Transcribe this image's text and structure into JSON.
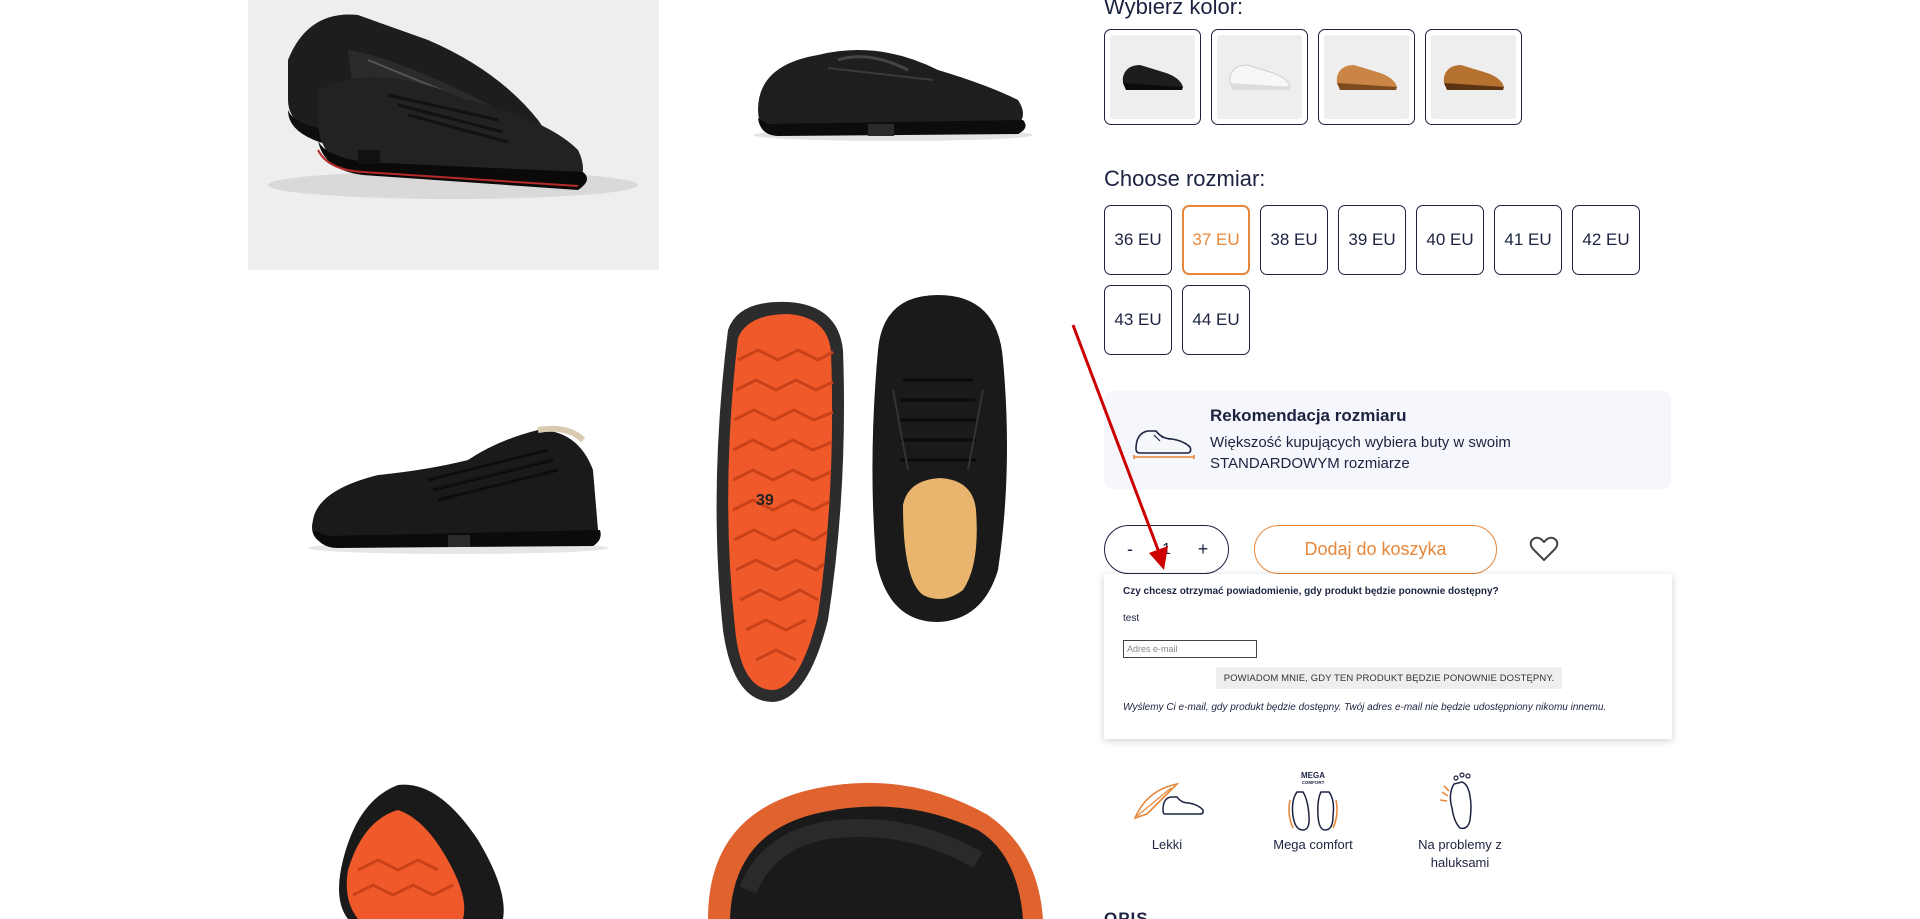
{
  "colors": {
    "accent": "#e8873a",
    "text": "#1c2340",
    "reco_bg": "#f5f7fc",
    "annotation_arrow": "#cc0000"
  },
  "gallery": {
    "images": [
      {
        "name": "black-shoe-pair-photo"
      },
      {
        "name": "black-shoe-side-photo"
      },
      {
        "name": "black-shoe-profile-photo"
      },
      {
        "name": "sole-and-top-photo"
      },
      {
        "name": "shoe-sole-angle-photo"
      },
      {
        "name": "shoe-flexed-photo"
      }
    ]
  },
  "color_picker": {
    "title": "Wybierz kolor:",
    "options": [
      {
        "name": "black"
      },
      {
        "name": "white"
      },
      {
        "name": "tan"
      },
      {
        "name": "brown"
      }
    ]
  },
  "size_picker": {
    "title": "Choose rozmiar:",
    "sizes": [
      "36 EU",
      "37 EU",
      "38 EU",
      "39 EU",
      "40 EU",
      "41 EU",
      "42 EU",
      "43 EU",
      "44 EU"
    ],
    "selected": "37 EU"
  },
  "recommendation": {
    "title": "Rekomendacja rozmiaru",
    "text": "Większość kupujących wybiera buty w swoim STANDARDOWYM rozmiarze"
  },
  "cart": {
    "minus": "-",
    "quantity": "1",
    "plus": "+",
    "add_label": "Dodaj do koszyka"
  },
  "notify": {
    "question": "Czy chcesz otrzymać powiadomienie, gdy produkt będzie ponownie dostępny?",
    "test_text": "test",
    "email_placeholder": "Adres e-mail",
    "button_label": "POWIADOM MNIE, GDY TEN PRODUKT BĘDZIE PONOWNIE DOSTĘPNY.",
    "note": "Wyślemy Ci e-mail, gdy produkt będzie dostępny. Twój adres e-mail nie będzie udostępniony nikomu innemu."
  },
  "features": [
    {
      "label": "Lekki",
      "icon": "feather-shoe-icon"
    },
    {
      "label": "Mega comfort",
      "icon": "mega-comfort-feet-icon",
      "badge_line1": "MEGA",
      "badge_line2": "COMFORT"
    },
    {
      "label": "Na problemy z haluksami",
      "icon": "foot-bunion-icon"
    }
  ],
  "description_heading": "OPIS"
}
